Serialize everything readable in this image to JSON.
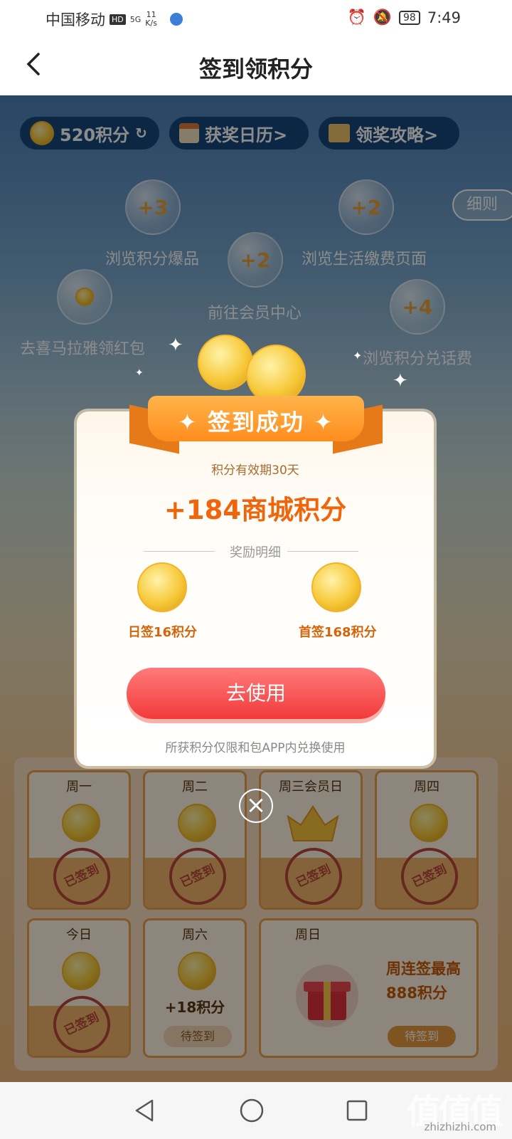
{
  "status_bar": {
    "carrier": "中国移动",
    "hd": "HD",
    "signal": "5G",
    "speed_value": "11",
    "speed_unit": "K/s",
    "battery": "98",
    "time": "7:49"
  },
  "header": {
    "title": "签到领积分"
  },
  "top_pills": {
    "points": "520积分",
    "calendar": "获奖日历>",
    "guide": "领奖攻略>"
  },
  "rules_label": "细则",
  "tasks": [
    {
      "bonus": "+3",
      "label": "浏览积分爆品"
    },
    {
      "bonus": "+2",
      "label": "浏览生活缴费页面"
    },
    {
      "bonus": "+2",
      "label": "前往会员中心"
    },
    {
      "bonus": "",
      "label": "去喜马拉雅领红包"
    },
    {
      "bonus": "+4",
      "label": "浏览积分兑话费"
    }
  ],
  "week": {
    "days": [
      {
        "label": "周一",
        "stamp": "已签到"
      },
      {
        "label": "周二",
        "stamp": "已签到"
      },
      {
        "label": "周三会员日",
        "stamp": "已签到"
      },
      {
        "label": "周四",
        "stamp": "已签到"
      },
      {
        "label": "今日",
        "stamp": "已签到"
      },
      {
        "label": "周六",
        "bonus": "+18积分",
        "pending": "待签到"
      },
      {
        "label": "周日",
        "promo_line1": "周连签最高",
        "promo_line2": "888积分",
        "pending": "待签到"
      }
    ]
  },
  "modal": {
    "ribbon": "签到成功",
    "validity": "积分有效期30天",
    "amount": "+184商城积分",
    "detail_title": "奖励明细",
    "rewards": [
      {
        "label": "日签16积分"
      },
      {
        "label": "首签168积分"
      }
    ],
    "use_button": "去使用",
    "note": "所获积分仅限和包APP内兑换使用"
  },
  "watermark": {
    "big": "值值值",
    "small": "zhizhizhi.com"
  },
  "colors": {
    "accent_orange": "#f0650c",
    "button_red": "#f23a3a",
    "pill_blue": "#16487a"
  }
}
